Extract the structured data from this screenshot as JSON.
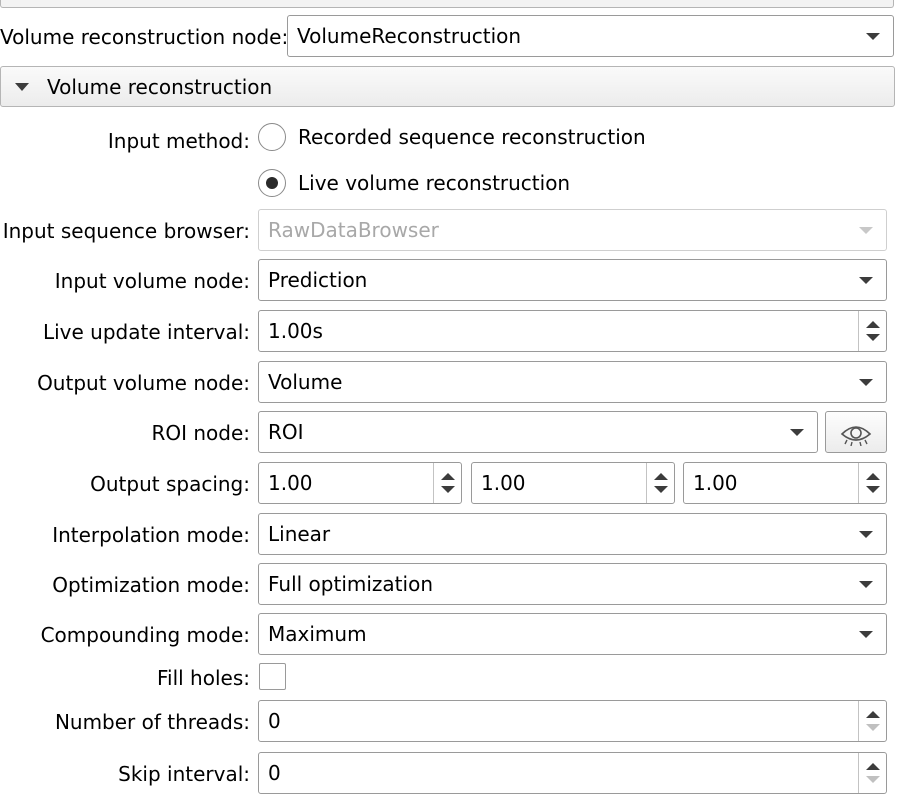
{
  "volume_reconstruction_node": {
    "label": "Volume reconstruction node:",
    "value": "VolumeReconstruction"
  },
  "section": {
    "title": "Volume reconstruction"
  },
  "input_method": {
    "label": "Input method:",
    "options": [
      {
        "label": "Recorded sequence reconstruction",
        "checked": false
      },
      {
        "label": "Live volume reconstruction",
        "checked": true
      }
    ]
  },
  "input_sequence_browser": {
    "label": "Input sequence browser:",
    "value": "RawDataBrowser",
    "enabled": false
  },
  "input_volume_node": {
    "label": "Input volume node:",
    "value": "Prediction"
  },
  "live_update_interval": {
    "label": "Live update interval:",
    "value": "1.00s"
  },
  "output_volume_node": {
    "label": "Output volume node:",
    "value": "Volume"
  },
  "roi_node": {
    "label": "ROI node:",
    "value": "ROI",
    "button_icon": "eye-icon"
  },
  "output_spacing": {
    "label": "Output spacing:",
    "values": [
      "1.00",
      "1.00",
      "1.00"
    ]
  },
  "interpolation_mode": {
    "label": "Interpolation mode:",
    "value": "Linear"
  },
  "optimization_mode": {
    "label": "Optimization mode:",
    "value": "Full optimization"
  },
  "compounding_mode": {
    "label": "Compounding mode:",
    "value": "Maximum"
  },
  "fill_holes": {
    "label": "Fill holes:",
    "checked": false
  },
  "number_of_threads": {
    "label": "Number of threads:",
    "value": "0"
  },
  "skip_interval": {
    "label": "Skip interval:",
    "value": "0"
  }
}
